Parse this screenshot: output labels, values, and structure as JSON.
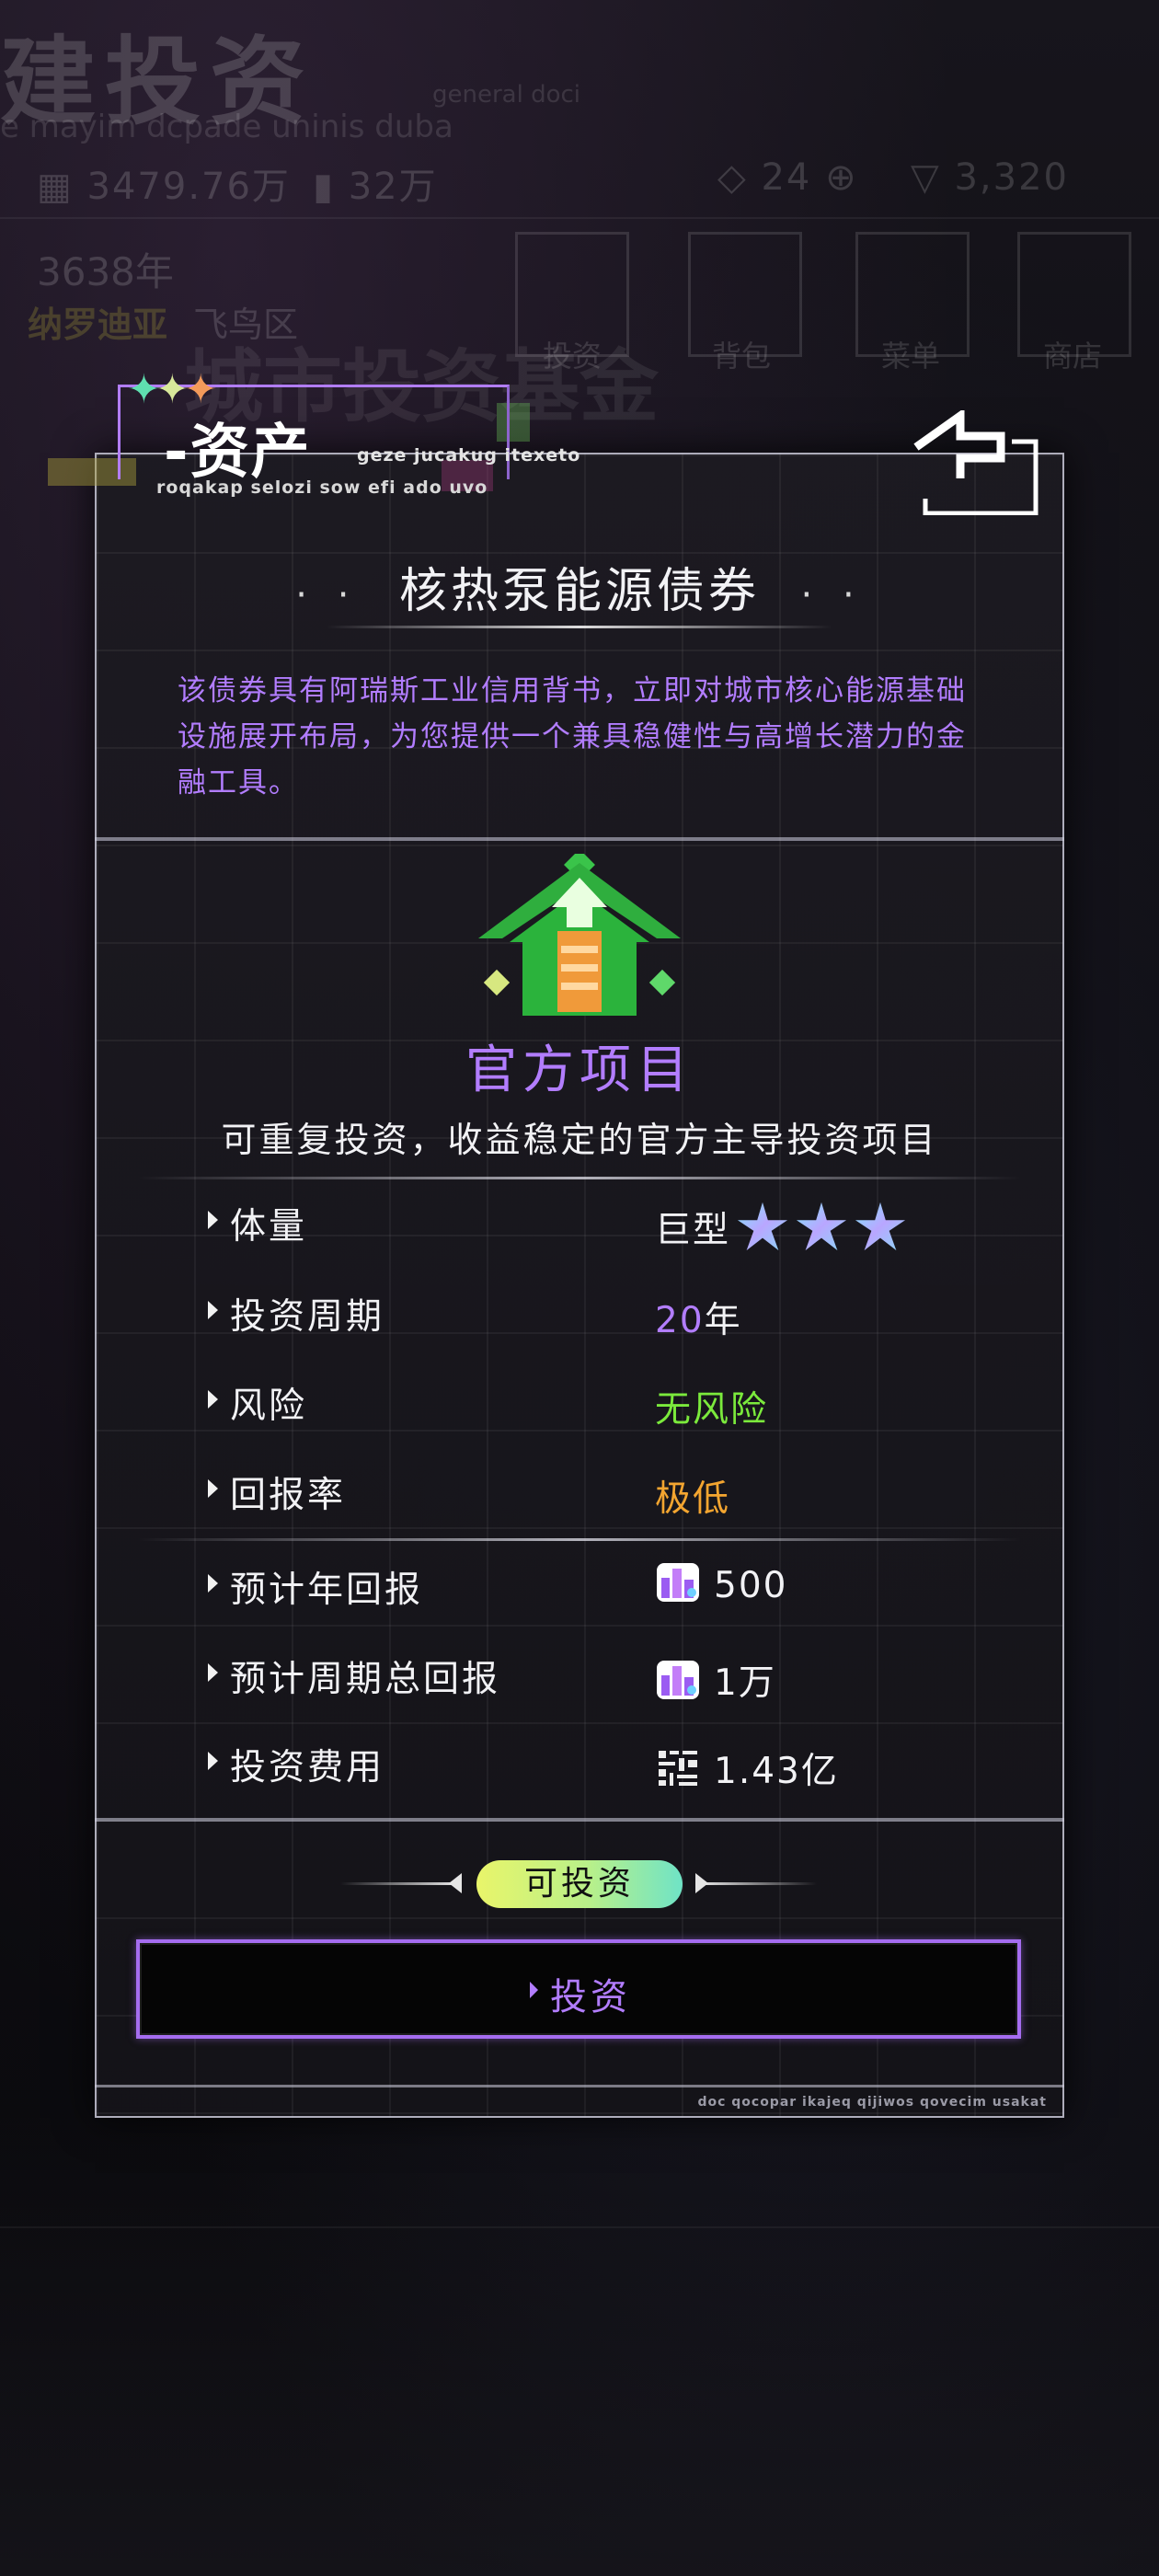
{
  "background": {
    "title": "建投资",
    "subtitle": "e mayim dcpade uninis duba",
    "general_doc": "general doci",
    "money": "3479.76万",
    "points": "32万",
    "gems": "24",
    "energy": "3,320",
    "year": "3638年",
    "city": "纳罗迪亚",
    "district": "飞鸟区",
    "menu_items": [
      "投资",
      "背包",
      "菜单",
      "商店"
    ],
    "fund": "城市投资基金"
  },
  "header": {
    "title": "-资产",
    "subtitle1": "geze jucakug itexeto",
    "subtitle2": "roqakap selozi sow efi ado uvo"
  },
  "bond": {
    "title": "核热泵能源债券",
    "dots": "· ·",
    "description": "该债券具有阿瑞斯工业信用背书，立即对城市核心能源基础设施展开布局，为您提供一个兼具稳健性与高增长潜力的金融工具。"
  },
  "project": {
    "type": "官方项目",
    "description": "可重复投资，收益稳定的官方主导投资项目"
  },
  "stats": {
    "volume_label": "体量",
    "volume_value": "巨型",
    "volume_stars": 3,
    "period_label": "投资周期",
    "period_number": "20",
    "period_unit": "年",
    "risk_label": "风险",
    "risk_value": "无风险",
    "return_rate_label": "回报率",
    "return_rate_value": "极低"
  },
  "returns": {
    "annual_label": "预计年回报",
    "annual_value": "500",
    "total_label": "预计周期总回报",
    "total_value": "1万",
    "cost_label": "投资费用",
    "cost_value": "1.43亿"
  },
  "status": {
    "label": "可投资"
  },
  "action": {
    "invest_label": "投资"
  },
  "footer": {
    "text": "doc qocopar ikajeq qijiwos qovecim usakat"
  },
  "colors": {
    "accent_purple": "#b27dff",
    "risk_green": "#7bea3c",
    "return_orange": "#f3a530",
    "pill_start": "#e9f56a",
    "pill_end": "#6fe3c6"
  },
  "icons": {
    "back": "back-arrow-icon",
    "project": "official-project-icon",
    "star": "star-icon",
    "points": "building-points-icon",
    "money": "money-icon"
  }
}
